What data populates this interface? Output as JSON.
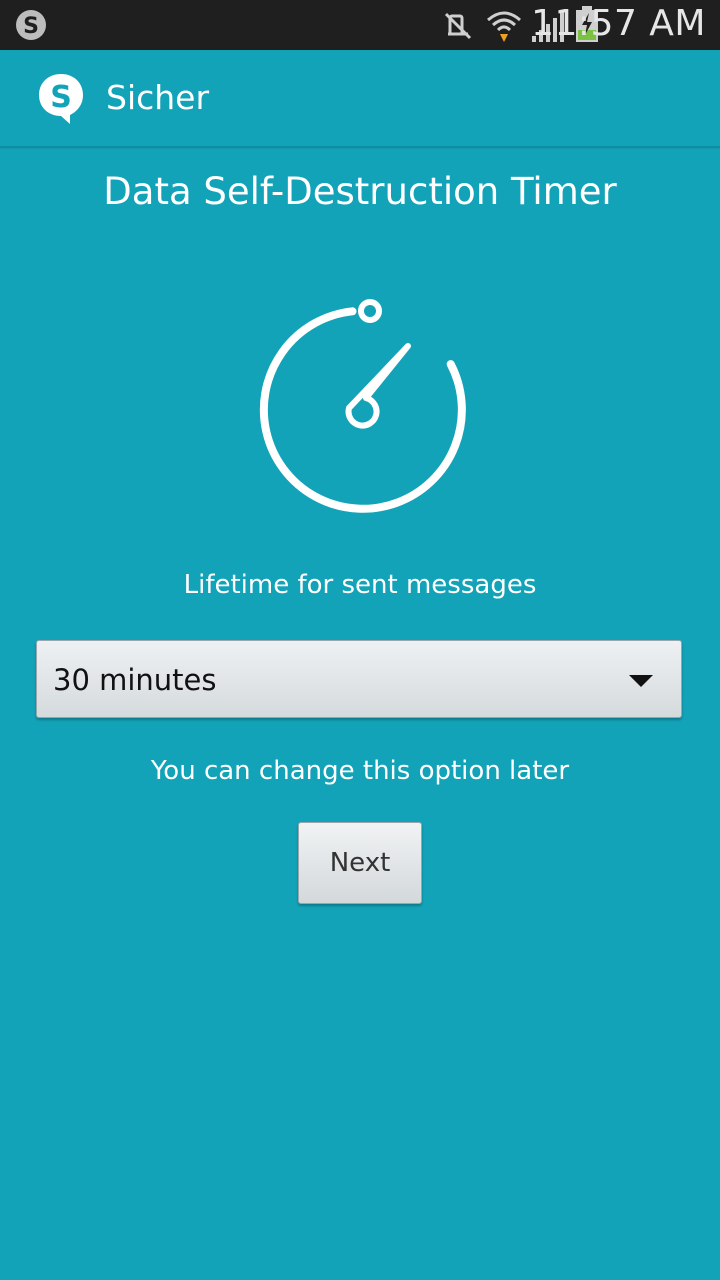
{
  "status_bar": {
    "time": "11:57 AM",
    "icons": [
      "skype-notification-icon",
      "mute-icon",
      "wifi-icon",
      "signal-icon",
      "battery-charging-icon"
    ]
  },
  "action_bar": {
    "title": "Sicher",
    "logo_icon": "sicher-logo-icon"
  },
  "content": {
    "title": "Data Self-Destruction Timer",
    "timer_icon": "stopwatch-icon",
    "lifetime_label": "Lifetime for sent messages",
    "lifetime_select": {
      "value": "30 minutes"
    },
    "hint": "You can change this option later",
    "next_label": "Next"
  },
  "colors": {
    "background": "#12a3b8",
    "status_bar": "#1f1f1f",
    "accent_green": "#7cc242",
    "wifi_arrow": "#f0a020"
  }
}
